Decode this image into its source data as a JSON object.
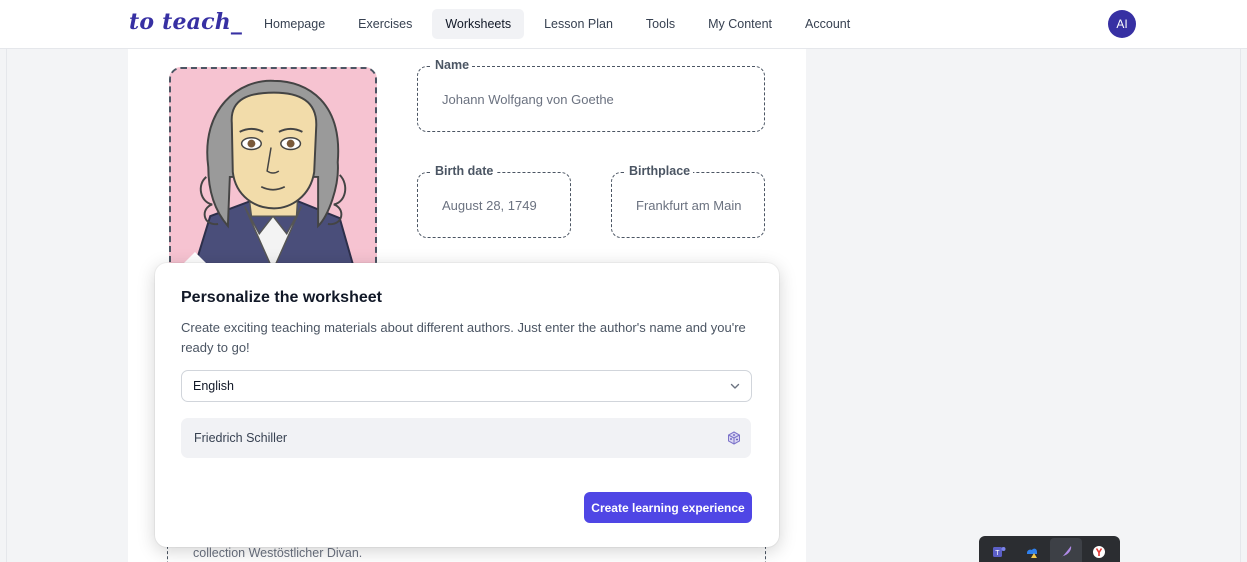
{
  "header": {
    "logo": "to teach_",
    "nav": [
      {
        "label": "Homepage",
        "active": false
      },
      {
        "label": "Exercises",
        "active": false
      },
      {
        "label": "Worksheets",
        "active": true
      },
      {
        "label": "Lesson Plan",
        "active": false
      },
      {
        "label": "Tools",
        "active": false
      },
      {
        "label": "My Content",
        "active": false
      },
      {
        "label": "Account",
        "active": false
      }
    ],
    "avatar_initials": "AI"
  },
  "worksheet": {
    "name_label": "Name",
    "name_value": "Johann Wolfgang von Goethe",
    "birth_date_label": "Birth date",
    "birth_date_value": "August 28, 1749",
    "birthplace_label": "Birthplace",
    "birthplace_value": "Frankfurt am Main",
    "bottom_text": "collection Westöstlicher Divan."
  },
  "dialog": {
    "title": "Personalize the worksheet",
    "description": "Create exciting teaching materials about different authors. Just enter the author's name and you're ready to go!",
    "language_select": {
      "value": "English",
      "icon": "chevron-down-icon"
    },
    "author_input": {
      "value": "Friedrich Schiller",
      "icon": "dice-icon"
    },
    "submit_label": "Create learning experience"
  },
  "tray": {
    "icons": [
      "teams-icon",
      "onedrive-alert-icon",
      "feather-icon",
      "yandex-icon"
    ]
  },
  "colors": {
    "brand": "#3730a3",
    "button": "#4f46e5",
    "portrait_bg": "#f6c3d1"
  }
}
